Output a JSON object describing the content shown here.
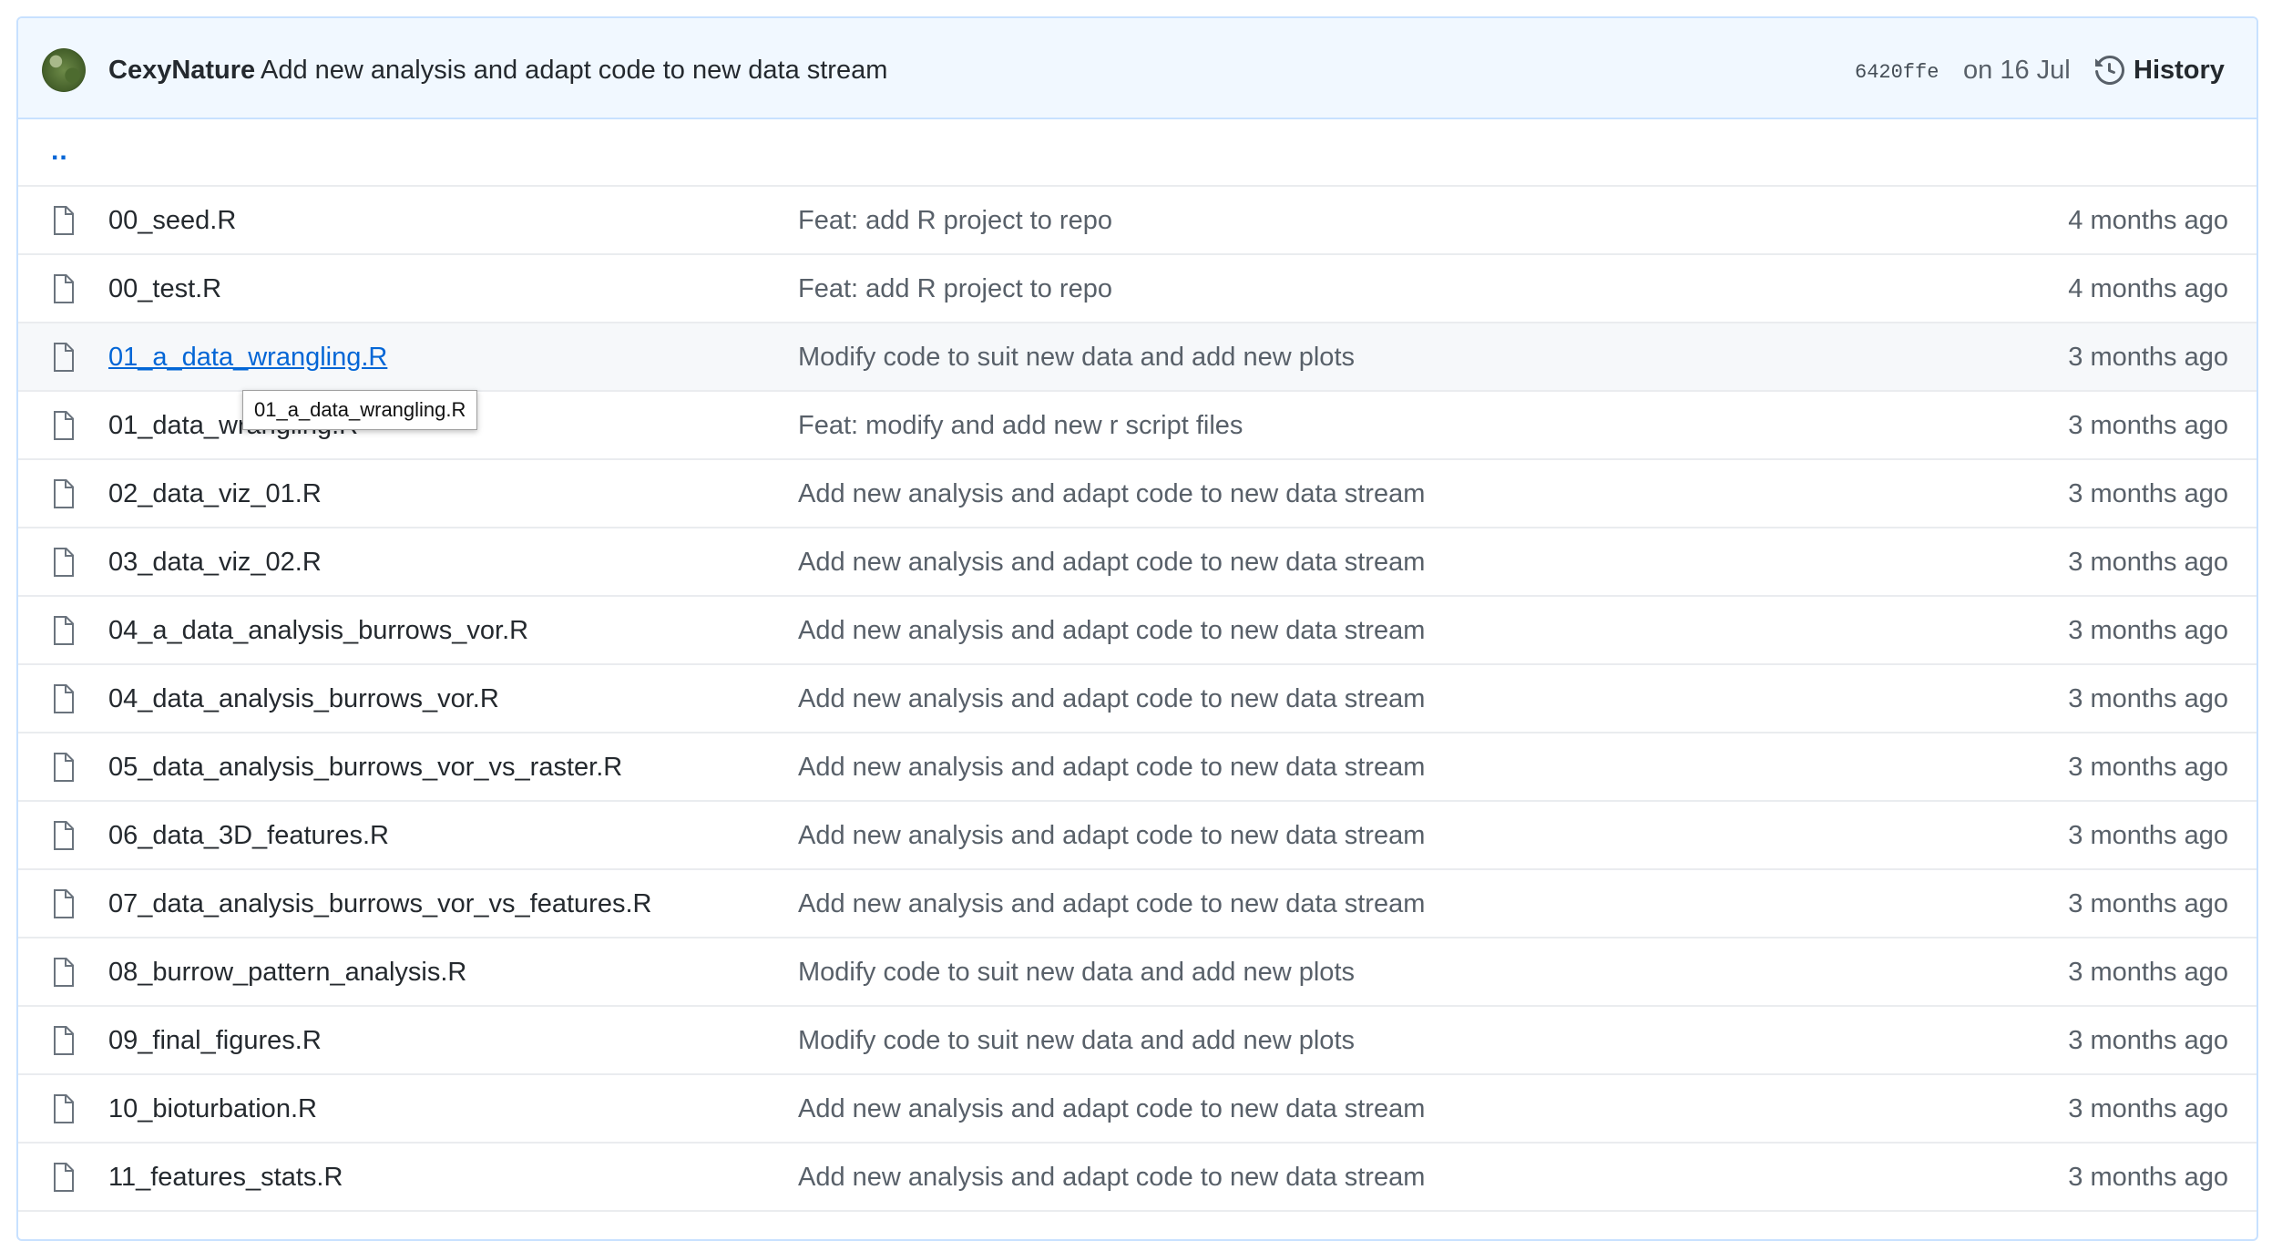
{
  "commit": {
    "author": "CexyNature",
    "message": "Add new analysis and adapt code to new data stream",
    "sha": "6420ffe",
    "date": "on 16 Jul",
    "history_label": "History"
  },
  "parent_dir": "..",
  "tooltip": "01_a_data_wrangling.R",
  "files": [
    {
      "name": "00_seed.R",
      "message": "Feat: add R project to repo",
      "age": "4 months ago"
    },
    {
      "name": "00_test.R",
      "message": "Feat: add R project to repo",
      "age": "4 months ago"
    },
    {
      "name": "01_a_data_wrangling.R",
      "message": "Modify code to suit new data and add new plots",
      "age": "3 months ago"
    },
    {
      "name": "01_data_wrangling.R",
      "message": "Feat: modify and add new r script files",
      "age": "3 months ago"
    },
    {
      "name": "02_data_viz_01.R",
      "message": "Add new analysis and adapt code to new data stream",
      "age": "3 months ago"
    },
    {
      "name": "03_data_viz_02.R",
      "message": "Add new analysis and adapt code to new data stream",
      "age": "3 months ago"
    },
    {
      "name": "04_a_data_analysis_burrows_vor.R",
      "message": "Add new analysis and adapt code to new data stream",
      "age": "3 months ago"
    },
    {
      "name": "04_data_analysis_burrows_vor.R",
      "message": "Add new analysis and adapt code to new data stream",
      "age": "3 months ago"
    },
    {
      "name": "05_data_analysis_burrows_vor_vs_raster.R",
      "message": "Add new analysis and adapt code to new data stream",
      "age": "3 months ago"
    },
    {
      "name": "06_data_3D_features.R",
      "message": "Add new analysis and adapt code to new data stream",
      "age": "3 months ago"
    },
    {
      "name": "07_data_analysis_burrows_vor_vs_features.R",
      "message": "Add new analysis and adapt code to new data stream",
      "age": "3 months ago"
    },
    {
      "name": "08_burrow_pattern_analysis.R",
      "message": "Modify code to suit new data and add new plots",
      "age": "3 months ago"
    },
    {
      "name": "09_final_figures.R",
      "message": "Modify code to suit new data and add new plots",
      "age": "3 months ago"
    },
    {
      "name": "10_bioturbation.R",
      "message": "Add new analysis and adapt code to new data stream",
      "age": "3 months ago"
    },
    {
      "name": "11_features_stats.R",
      "message": "Add new analysis and adapt code to new data stream",
      "age": "3 months ago"
    }
  ]
}
